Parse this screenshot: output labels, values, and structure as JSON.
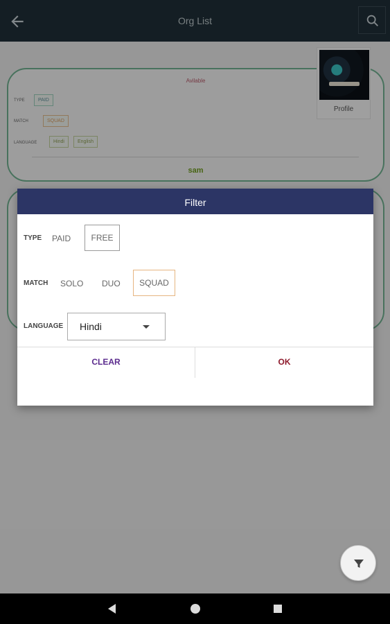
{
  "appbar": {
    "title": "Org List",
    "back_icon": "arrow-back-icon",
    "search_icon": "search-icon"
  },
  "card": {
    "availability": "Avilable",
    "type_label": "TYPE",
    "type_value": "PAID",
    "match_label": "MATCH",
    "match_value": "SQUAD",
    "language_label": "LANGUAGE",
    "languages": [
      "Hindi",
      "English"
    ],
    "name": "sam",
    "profile_label": "Profile"
  },
  "dialog": {
    "title": "Filter",
    "type_label": "TYPE",
    "type_options": [
      "PAID",
      "FREE"
    ],
    "type_selected": "FREE",
    "match_label": "MATCH",
    "match_options": [
      "SOLO",
      "DUO",
      "SQUAD"
    ],
    "match_selected": "SQUAD",
    "language_label": "LANGUAGE",
    "language_value": "Hindi",
    "clear_label": "CLEAR",
    "ok_label": "OK"
  },
  "fab": {
    "icon": "filter-icon"
  },
  "navbar": {
    "back": "nav-back-icon",
    "home": "nav-home-icon",
    "recent": "nav-recent-icon"
  },
  "colors": {
    "appbar": "#1f2f38",
    "dialog_header": "#2c3565",
    "clear": "#5b2b8e",
    "ok": "#8e1a2c",
    "card_border": "#6fb08f"
  }
}
